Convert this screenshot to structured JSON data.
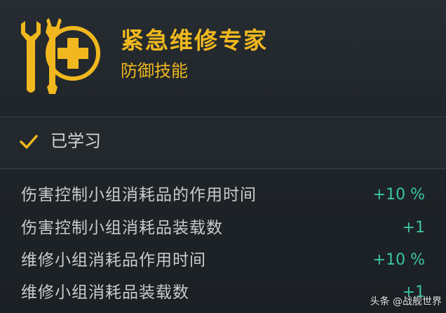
{
  "skill": {
    "icon": "wrench-medkit-icon",
    "title": "紧急维修专家",
    "category": "防御技能"
  },
  "status": {
    "icon": "checkmark-icon",
    "label": "已学习"
  },
  "stats": [
    {
      "name": "伤害控制小组消耗品的作用时间",
      "value": "+10 %"
    },
    {
      "name": "伤害控制小组消耗品装载数",
      "value": "+1"
    },
    {
      "name": "维修小组消耗品作用时间",
      "value": "+10 %"
    },
    {
      "name": "维修小组消耗品装载数",
      "value": "+1"
    }
  ],
  "watermark": "头条 @战舰世界",
  "colors": {
    "accent": "#f0b81e",
    "positive": "#39c7a0"
  }
}
